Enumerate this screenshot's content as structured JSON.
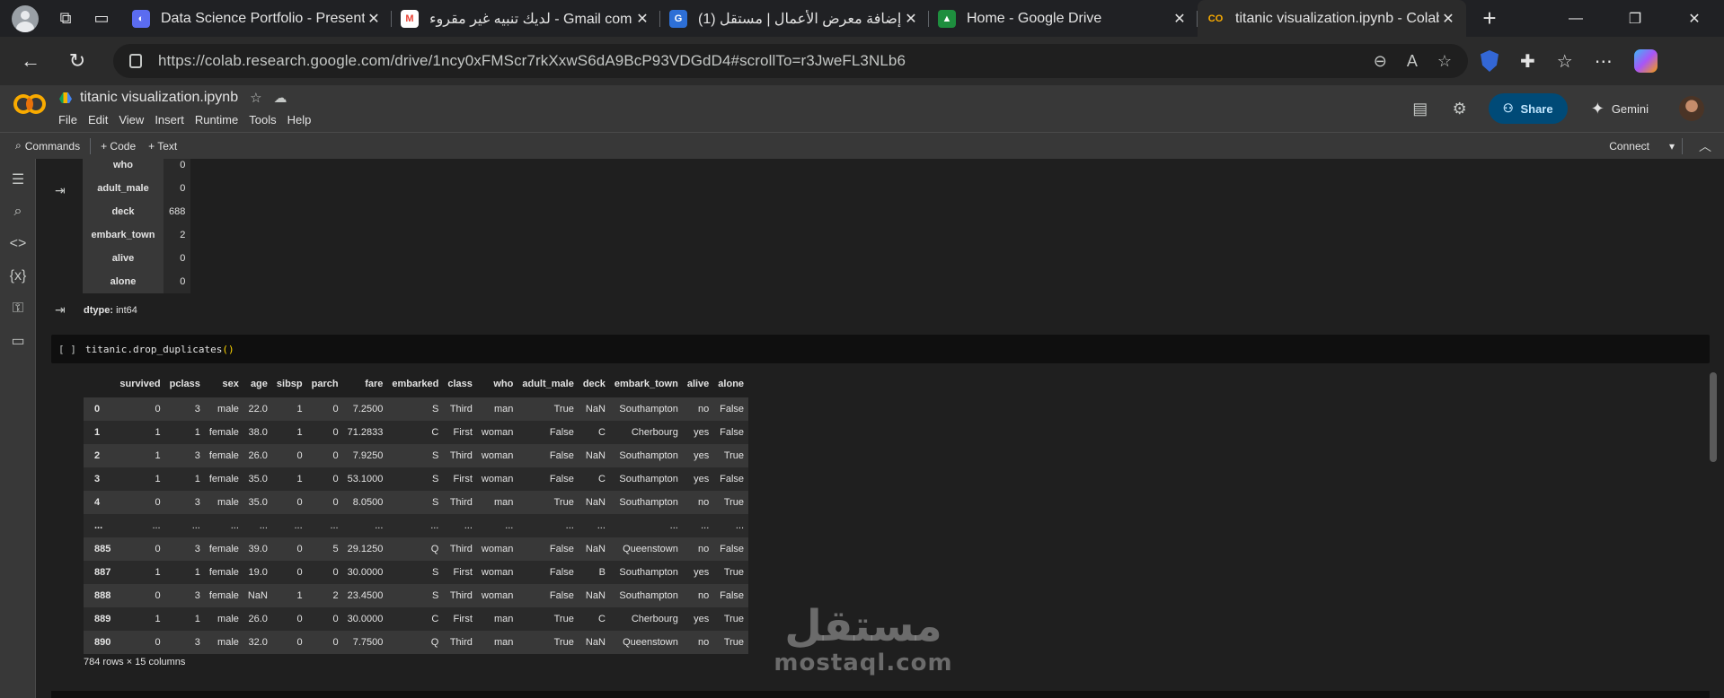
{
  "browser": {
    "tabs": [
      {
        "title": "Data Science Portfolio - Presentat",
        "favicon_color": "#5b6cf0",
        "favicon_glyph": "◐"
      },
      {
        "title": "لديك تنبيه غير مقروء - Gmail com.",
        "favicon_color": "#ffffff",
        "favicon_glyph": "M"
      },
      {
        "title": "(1) إضافة معرض الأعمال | مستقل",
        "favicon_color": "#2d6fd6",
        "favicon_glyph": "G"
      },
      {
        "title": "Home - Google Drive",
        "favicon_color": "#1e8e3e",
        "favicon_glyph": "▲"
      },
      {
        "title": "titanic visualization.ipynb - Colab",
        "favicon_color": "#f9ab00",
        "favicon_glyph": "CO"
      }
    ],
    "close_glyph": "✕",
    "new_tab_glyph": "+",
    "url": "https://colab.research.google.com/drive/1ncy0xFMScr7rkXxwS6dA9BcP93VDGdD4#scrollTo=r3JweFL3NLb6"
  },
  "colab": {
    "notebook_title": "titanic visualization.ipynb",
    "menu": [
      "File",
      "Edit",
      "View",
      "Insert",
      "Runtime",
      "Tools",
      "Help"
    ],
    "share_label": "Share",
    "gemini_label": "Gemini",
    "toolbar": {
      "commands_label": "Commands",
      "code_label": "+ Code",
      "text_label": "+ Text",
      "connect_label": "Connect"
    }
  },
  "stat_output": {
    "rows": [
      {
        "key": "who",
        "value": "0"
      },
      {
        "key": "adult_male",
        "value": "0"
      },
      {
        "key": "deck",
        "value": "688"
      },
      {
        "key": "embark_town",
        "value": "2"
      },
      {
        "key": "alive",
        "value": "0"
      },
      {
        "key": "alone",
        "value": "0"
      }
    ],
    "dtype_label": "dtype:",
    "dtype_value": "int64"
  },
  "code_cell": {
    "bracket": "[ ]",
    "code_prefix": "titanic.drop_duplicates",
    "code_parens": "()"
  },
  "dataframe": {
    "columns": [
      "",
      "survived",
      "pclass",
      "sex",
      "age",
      "sibsp",
      "parch",
      "fare",
      "embarked",
      "class",
      "who",
      "adult_male",
      "deck",
      "embark_town",
      "alive",
      "alone"
    ],
    "rows": [
      [
        "0",
        "0",
        "3",
        "male",
        "22.0",
        "1",
        "0",
        "7.2500",
        "S",
        "Third",
        "man",
        "True",
        "NaN",
        "Southampton",
        "no",
        "False"
      ],
      [
        "1",
        "1",
        "1",
        "female",
        "38.0",
        "1",
        "0",
        "71.2833",
        "C",
        "First",
        "woman",
        "False",
        "C",
        "Cherbourg",
        "yes",
        "False"
      ],
      [
        "2",
        "1",
        "3",
        "female",
        "26.0",
        "0",
        "0",
        "7.9250",
        "S",
        "Third",
        "woman",
        "False",
        "NaN",
        "Southampton",
        "yes",
        "True"
      ],
      [
        "3",
        "1",
        "1",
        "female",
        "35.0",
        "1",
        "0",
        "53.1000",
        "S",
        "First",
        "woman",
        "False",
        "C",
        "Southampton",
        "yes",
        "False"
      ],
      [
        "4",
        "0",
        "3",
        "male",
        "35.0",
        "0",
        "0",
        "8.0500",
        "S",
        "Third",
        "man",
        "True",
        "NaN",
        "Southampton",
        "no",
        "True"
      ],
      [
        "...",
        "...",
        "...",
        "...",
        "...",
        "...",
        "...",
        "...",
        "...",
        "...",
        "...",
        "...",
        "...",
        "...",
        "...",
        "..."
      ],
      [
        "885",
        "0",
        "3",
        "female",
        "39.0",
        "0",
        "5",
        "29.1250",
        "Q",
        "Third",
        "woman",
        "False",
        "NaN",
        "Queenstown",
        "no",
        "False"
      ],
      [
        "887",
        "1",
        "1",
        "female",
        "19.0",
        "0",
        "0",
        "30.0000",
        "S",
        "First",
        "woman",
        "False",
        "B",
        "Southampton",
        "yes",
        "True"
      ],
      [
        "888",
        "0",
        "3",
        "female",
        "NaN",
        "1",
        "2",
        "23.4500",
        "S",
        "Third",
        "woman",
        "False",
        "NaN",
        "Southampton",
        "no",
        "False"
      ],
      [
        "889",
        "1",
        "1",
        "male",
        "26.0",
        "0",
        "0",
        "30.0000",
        "C",
        "First",
        "man",
        "True",
        "C",
        "Cherbourg",
        "yes",
        "True"
      ],
      [
        "890",
        "0",
        "3",
        "male",
        "32.0",
        "0",
        "0",
        "7.7500",
        "Q",
        "Third",
        "man",
        "True",
        "NaN",
        "Queenstown",
        "no",
        "True"
      ]
    ],
    "shape_label": "784 rows × 15 columns"
  },
  "watermark": {
    "arabic": "مستقل",
    "latin": "mostaql.com"
  }
}
